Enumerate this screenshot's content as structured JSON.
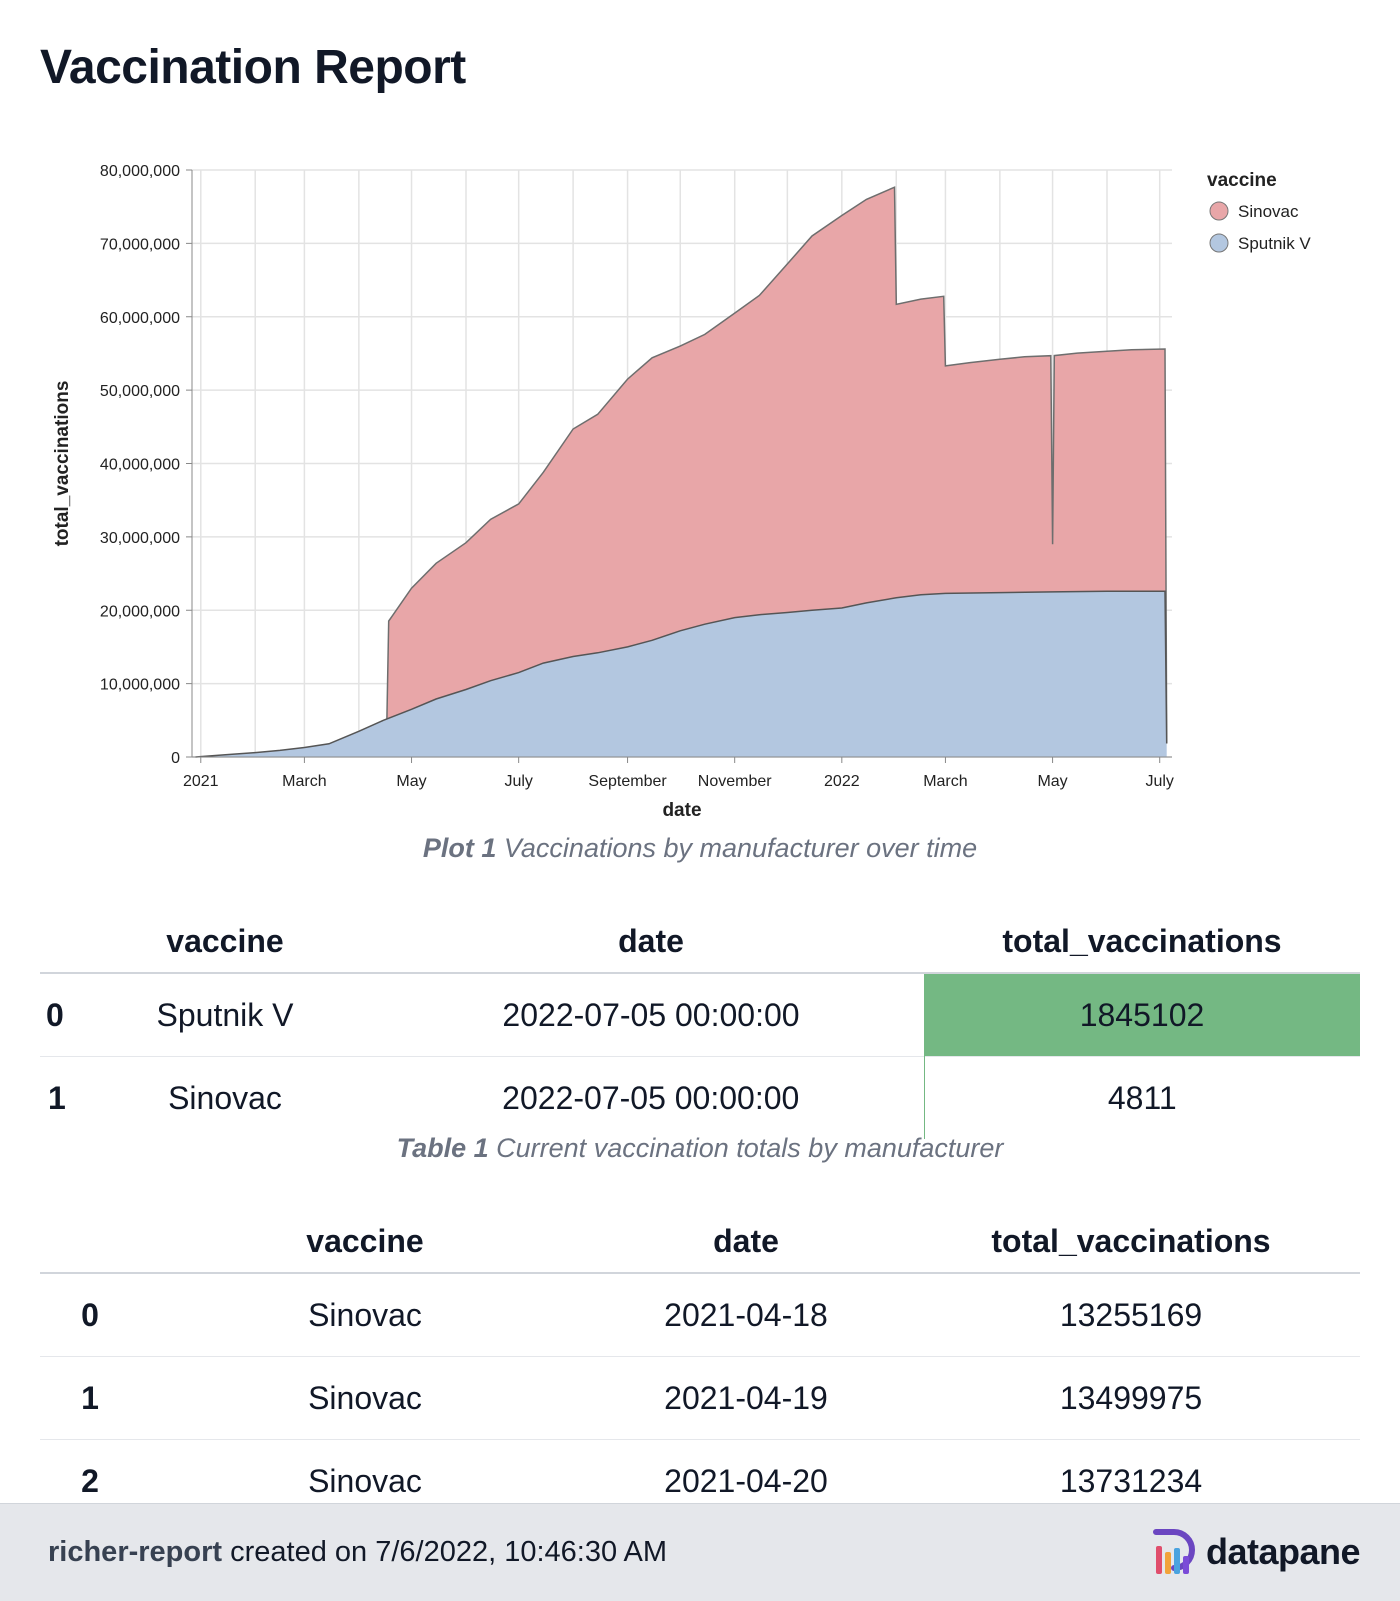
{
  "report": {
    "title": "Vaccination Report"
  },
  "chart_data": {
    "type": "area",
    "stacked": true,
    "title": "",
    "xlabel": "date",
    "ylabel": "total_vaccinations",
    "x_tick_labels": [
      "2021",
      "March",
      "May",
      "July",
      "September",
      "November",
      "2022",
      "March",
      "May",
      "July"
    ],
    "x_tick_dates": [
      "2021-01-01",
      "2021-03-01",
      "2021-05-01",
      "2021-07-01",
      "2021-09-01",
      "2021-11-01",
      "2022-01-01",
      "2022-03-01",
      "2022-05-01",
      "2022-07-01"
    ],
    "y_tick_labels": [
      "0",
      "10,000,000",
      "20,000,000",
      "30,000,000",
      "40,000,000",
      "50,000,000",
      "60,000,000",
      "70,000,000",
      "80,000,000"
    ],
    "ylim": [
      0,
      80000000
    ],
    "grid": true,
    "legend": {
      "title": "vaccine",
      "position": "top-right"
    },
    "series": [
      {
        "name": "Sputnik V",
        "color": "#b3c7e0",
        "points": [
          [
            "2020-12-29",
            0
          ],
          [
            "2021-01-15",
            300000
          ],
          [
            "2021-02-01",
            600000
          ],
          [
            "2021-02-15",
            900000
          ],
          [
            "2021-03-01",
            1300000
          ],
          [
            "2021-03-15",
            1800000
          ],
          [
            "2021-04-01",
            3500000
          ],
          [
            "2021-04-15",
            5000000
          ],
          [
            "2021-05-01",
            6500000
          ],
          [
            "2021-05-15",
            7900000
          ],
          [
            "2021-06-01",
            9200000
          ],
          [
            "2021-06-15",
            10400000
          ],
          [
            "2021-07-01",
            11500000
          ],
          [
            "2021-07-15",
            12800000
          ],
          [
            "2021-08-01",
            13700000
          ],
          [
            "2021-08-15",
            14200000
          ],
          [
            "2021-09-01",
            15000000
          ],
          [
            "2021-09-15",
            15900000
          ],
          [
            "2021-10-01",
            17200000
          ],
          [
            "2021-10-15",
            18100000
          ],
          [
            "2021-11-01",
            19000000
          ],
          [
            "2021-11-15",
            19400000
          ],
          [
            "2021-12-01",
            19700000
          ],
          [
            "2021-12-15",
            20000000
          ],
          [
            "2022-01-01",
            20300000
          ],
          [
            "2022-01-15",
            21000000
          ],
          [
            "2022-02-01",
            21700000
          ],
          [
            "2022-02-15",
            22100000
          ],
          [
            "2022-03-01",
            22300000
          ],
          [
            "2022-04-01",
            22400000
          ],
          [
            "2022-05-01",
            22500000
          ],
          [
            "2022-06-01",
            22600000
          ],
          [
            "2022-07-04",
            22600000
          ],
          [
            "2022-07-05",
            1845102
          ]
        ]
      },
      {
        "name": "Sinovac",
        "color": "#e8a6a8",
        "points": [
          [
            "2021-04-17",
            0
          ],
          [
            "2021-04-18",
            13255169
          ],
          [
            "2021-04-19",
            13499975
          ],
          [
            "2021-04-20",
            13731234
          ],
          [
            "2021-05-01",
            16500000
          ],
          [
            "2021-05-15",
            18500000
          ],
          [
            "2021-06-01",
            20000000
          ],
          [
            "2021-06-15",
            22000000
          ],
          [
            "2021-07-01",
            23000000
          ],
          [
            "2021-07-15",
            26000000
          ],
          [
            "2021-08-01",
            31000000
          ],
          [
            "2021-08-15",
            32500000
          ],
          [
            "2021-09-01",
            36500000
          ],
          [
            "2021-09-15",
            38500000
          ],
          [
            "2021-10-01",
            38800000
          ],
          [
            "2021-10-15",
            39500000
          ],
          [
            "2021-11-01",
            41500000
          ],
          [
            "2021-11-15",
            43500000
          ],
          [
            "2021-12-01",
            47500000
          ],
          [
            "2021-12-15",
            51000000
          ],
          [
            "2022-01-01",
            53500000
          ],
          [
            "2022-01-15",
            55000000
          ],
          [
            "2022-01-31",
            56000000
          ],
          [
            "2022-02-01",
            40000000
          ],
          [
            "2022-02-15",
            40300000
          ],
          [
            "2022-02-28",
            40500000
          ],
          [
            "2022-03-01",
            31000000
          ],
          [
            "2022-03-15",
            31400000
          ],
          [
            "2022-04-01",
            31800000
          ],
          [
            "2022-04-15",
            32100000
          ],
          [
            "2022-04-30",
            32200000
          ],
          [
            "2022-05-01",
            6500000
          ],
          [
            "2022-05-02",
            32200000
          ],
          [
            "2022-05-15",
            32500000
          ],
          [
            "2022-06-01",
            32700000
          ],
          [
            "2022-06-15",
            32900000
          ],
          [
            "2022-07-04",
            33000000
          ],
          [
            "2022-07-05",
            4811
          ]
        ]
      }
    ]
  },
  "plot_caption": {
    "label": "Plot 1",
    "text": "Vaccinations by manufacturer over time"
  },
  "table1": {
    "columns": [
      "vaccine",
      "date",
      "total_vaccinations"
    ],
    "rows": [
      {
        "index": "0",
        "vaccine": "Sputnik V",
        "date": "2022-07-05 00:00:00",
        "total_vaccinations": "1845102"
      },
      {
        "index": "1",
        "vaccine": "Sinovac",
        "date": "2022-07-05 00:00:00",
        "total_vaccinations": "4811"
      }
    ],
    "highlight_color": "#74b883",
    "caption_label": "Table 1",
    "caption_text": "Current vaccination totals by manufacturer"
  },
  "table2": {
    "columns": [
      "vaccine",
      "date",
      "total_vaccinations"
    ],
    "rows": [
      {
        "index": "0",
        "vaccine": "Sinovac",
        "date": "2021-04-18",
        "total_vaccinations": "13255169"
      },
      {
        "index": "1",
        "vaccine": "Sinovac",
        "date": "2021-04-19",
        "total_vaccinations": "13499975"
      },
      {
        "index": "2",
        "vaccine": "Sinovac",
        "date": "2021-04-20",
        "total_vaccinations": "13731234"
      }
    ]
  },
  "footer": {
    "report_name": "richer-report",
    "created_text": "created on 7/6/2022, 10:46:30 AM",
    "brand": "datapane",
    "brand_colors": [
      "#e04e6c",
      "#f2a33a",
      "#4aa3df",
      "#7b4bd8"
    ]
  }
}
